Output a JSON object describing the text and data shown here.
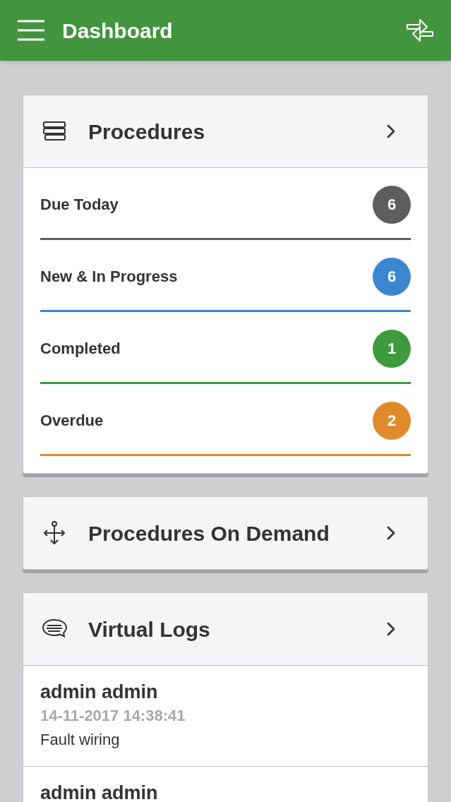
{
  "app_bar": {
    "title": "Dashboard"
  },
  "procedures": {
    "title": "Procedures",
    "statuses": [
      {
        "label": "Due Today",
        "count": "6",
        "color": "#5e5e5e"
      },
      {
        "label": "New & In Progress",
        "count": "6",
        "color": "#3b87cf"
      },
      {
        "label": "Completed",
        "count": "1",
        "color": "#3d9a3d"
      },
      {
        "label": "Overdue",
        "count": "2",
        "color": "#df8a2b"
      }
    ]
  },
  "on_demand": {
    "title": "Procedures On Demand"
  },
  "virtual_logs": {
    "title": "Virtual Logs",
    "entries": [
      {
        "author": "admin admin",
        "timestamp": "14-11-2017 14:38:41",
        "message": "Fault wiring"
      },
      {
        "author": "admin admin"
      }
    ]
  }
}
